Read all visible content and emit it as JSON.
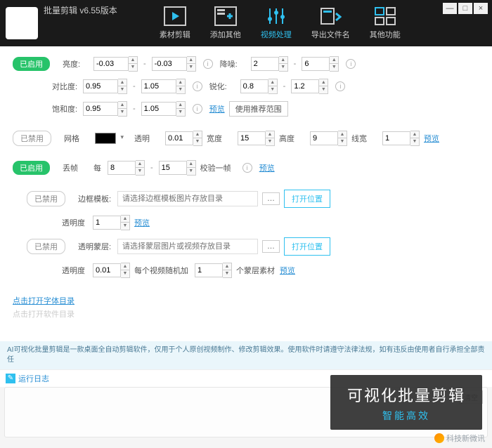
{
  "app": {
    "title": "批量剪辑 v6.55版本"
  },
  "nav": {
    "a": "素材剪辑",
    "b": "添加其他",
    "c": "视频处理",
    "d": "导出文件名",
    "e": "其他功能"
  },
  "win": {
    "min": "—",
    "max": "□",
    "close": "×"
  },
  "status": {
    "on": "已启用",
    "off": "已禁用"
  },
  "labels": {
    "brightness": "亮度:",
    "contrast": "对比度:",
    "saturation": "饱和度:",
    "noise": "降噪:",
    "sharpen": "锐化:",
    "grid": "网格",
    "opacity": "透明",
    "width": "宽度",
    "height": "高度",
    "line": "线宽",
    "dropframe": "丢帧",
    "per": "每",
    "checkone": "校验一帧",
    "bordertpl": "边框模板:",
    "transparency": "透明度",
    "opentpl": "打开位置",
    "overlay": "透明蒙层:",
    "eachvid": "每个视频随机加",
    "unit": "个蒙层素材",
    "preview": "预览",
    "recommend": "使用推荐范围"
  },
  "vals": {
    "bright_lo": "-0.03",
    "bright_hi": "-0.03",
    "contrast_lo": "0.95",
    "contrast_hi": "1.05",
    "sat_lo": "0.95",
    "sat_hi": "1.05",
    "noise_lo": "2",
    "noise_hi": "6",
    "sharp_lo": "0.8",
    "sharp_hi": "1.2",
    "grid_op": "0.01",
    "grid_w": "15",
    "grid_h": "9",
    "grid_lw": "1",
    "drop_lo": "8",
    "drop_hi": "15",
    "border_ph": "请选择边框模板图片存放目录",
    "border_op": "1",
    "mask_ph": "请选择蒙层图片或视频存放目录",
    "mask_op": "0.01",
    "mask_cnt": "1"
  },
  "links": {
    "fontdir": "点击打开字体目录",
    "disabled": "点击打开软件目录"
  },
  "disclaimer": "AI可视化批量剪辑是一款桌面全自动剪辑软件，仅用于个人原创视频制作、修改剪辑效果。使用软件时请遵守法律法规，如有违反由使用者自行承担全部责任",
  "log": {
    "title": "运行日志",
    "clear": "清空"
  },
  "overlay": {
    "t1": "可视化批量剪辑",
    "t2": "智能高效"
  },
  "watermark": "科技新微讯"
}
